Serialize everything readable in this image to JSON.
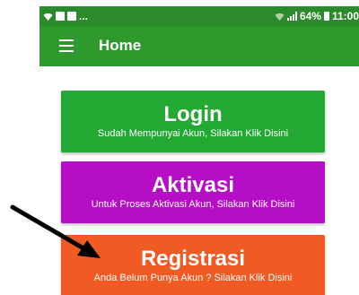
{
  "status_bar": {
    "notification_text": "...",
    "battery_text": "64%",
    "time_text": "11:00",
    "icons": [
      "wifi-icon",
      "notification-icon",
      "image-icon",
      "signal-icon",
      "battery-icon"
    ]
  },
  "app_bar": {
    "menu_icon": "hamburger-menu-icon",
    "title": "Home",
    "color": "#2e9a2e"
  },
  "buttons": {
    "login": {
      "title": "Login",
      "subtitle": "Sudah Mempunyai Akun, Silakan Klik Disini",
      "color": "#22a833"
    },
    "aktivasi": {
      "title": "Aktivasi",
      "subtitle": "Untuk Proses Aktivasi Akun, Silakan Klik Disini",
      "color": "#b50ec6"
    },
    "registrasi": {
      "title": "Registrasi",
      "subtitle": "Anda Belum Punya Akun ? Silakan Klik Disini",
      "color": "#f15a22"
    }
  },
  "annotation": {
    "icon": "arrow-icon",
    "color": "#000000"
  }
}
